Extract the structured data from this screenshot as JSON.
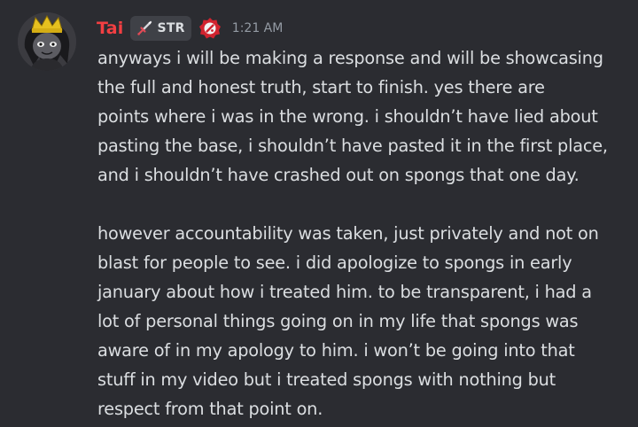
{
  "message": {
    "username": "Tai",
    "tag": {
      "icon": "sword-icon",
      "label": "STR"
    },
    "role_icon": "red-badge-icon",
    "timestamp": "1:21 AM",
    "paragraphs": [
      [
        "anyways i will be making a response and will be showcasing",
        "the full and honest truth, start to finish. yes there are",
        "points where i was in the wrong. i shouldn’t have lied about",
        "pasting the base, i shouldn’t have pasted it in the first place,",
        "and i shouldn’t have crashed out on spongs that one day."
      ],
      [
        "however accountability was taken, just privately and not on",
        "blast for people to see. i did apologize to spongs in early",
        "january about how i treated him. to be transparent, i had a",
        "lot of personal things going on in my life that spongs was",
        "aware of in my apology to him. i won’t be going into that",
        "stuff in my video but i treated spongs with nothing but",
        "respect from that point on."
      ]
    ]
  },
  "colors": {
    "background": "#2b2c31",
    "username": "#f23f42",
    "text": "#dbdee1",
    "timestamp": "#949ba4",
    "tag_bg": "#3f4147"
  }
}
